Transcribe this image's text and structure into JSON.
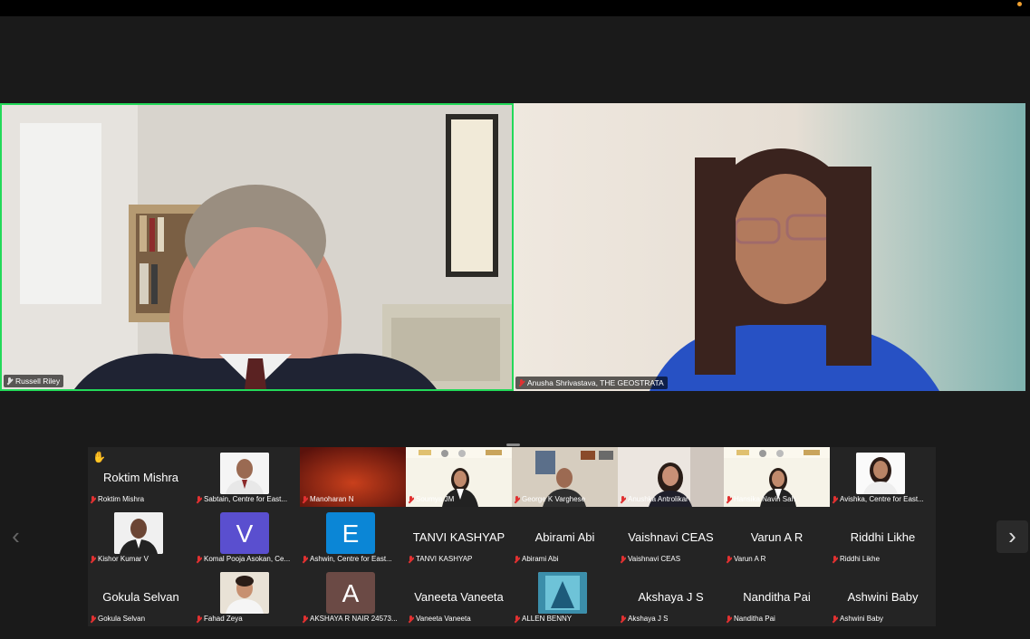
{
  "speakers": [
    {
      "name": "Russell Riley"
    },
    {
      "name": "Anusha Shrivastava, THE GEOSTRATA"
    }
  ],
  "gallery": {
    "rows": [
      [
        {
          "tag": "Roktim Mishra",
          "big": "Roktim Mishra",
          "kind": "name",
          "hand": true
        },
        {
          "tag": "Sabtain, Centre for East...",
          "kind": "photo",
          "photo": "suit-light"
        },
        {
          "tag": "Manoharan N",
          "kind": "video-red"
        },
        {
          "tag": "Soumya JM",
          "kind": "video-student"
        },
        {
          "tag": "George K Varghese",
          "kind": "video-room"
        },
        {
          "tag": "Anushka Antrolikar",
          "kind": "video-girl"
        },
        {
          "tag": "Hansika Navin Sah",
          "kind": "video-student"
        },
        {
          "tag": "Avishka, Centre for East...",
          "kind": "photo",
          "photo": "girl-white"
        }
      ],
      [
        {
          "tag": "Kishor Kumar V",
          "kind": "photo",
          "photo": "suit-dark"
        },
        {
          "tag": "Komal Pooja Asokan, Ce...",
          "kind": "avatar",
          "letter": "V",
          "color": "#5a4fcf"
        },
        {
          "tag": "Ashwin, Centre for East...",
          "kind": "avatar",
          "letter": "E",
          "color": "#0b86d6"
        },
        {
          "tag": "TANVI KASHYAP",
          "big": "TANVI KASHYAP",
          "kind": "name"
        },
        {
          "tag": "Abirami Abi",
          "big": "Abirami Abi",
          "kind": "name"
        },
        {
          "tag": "Vaishnavi CEAS",
          "big": "Vaishnavi CEAS",
          "kind": "name"
        },
        {
          "tag": "Varun A R",
          "big": "Varun A R",
          "kind": "name"
        },
        {
          "tag": "Riddhi Likhe",
          "big": "Riddhi Likhe",
          "kind": "name"
        }
      ],
      [
        {
          "tag": "Gokula Selvan",
          "big": "Gokula Selvan",
          "kind": "name"
        },
        {
          "tag": "Fahad Zeya",
          "kind": "photo",
          "photo": "man-white"
        },
        {
          "tag": "AKSHAYA R NAIR 24573...",
          "kind": "avatar",
          "letter": "A",
          "color": "#6b4a45"
        },
        {
          "tag": "Vaneeta Vaneeta",
          "big": "Vaneeta Vaneeta",
          "kind": "name"
        },
        {
          "tag": "ALLEN BENNY",
          "kind": "photo",
          "photo": "blue-art"
        },
        {
          "tag": "Akshaya J S",
          "big": "Akshaya J S",
          "kind": "name"
        },
        {
          "tag": "Nanditha Pai",
          "big": "Nanditha Pai",
          "kind": "name"
        },
        {
          "tag": "Ashwini Baby",
          "big": "Ashwini Baby",
          "kind": "name"
        }
      ]
    ]
  },
  "nav": {
    "left": "‹",
    "right": "›"
  },
  "colors": {
    "active_speaker_border": "#23d959",
    "muted_mic": "#e03131"
  }
}
